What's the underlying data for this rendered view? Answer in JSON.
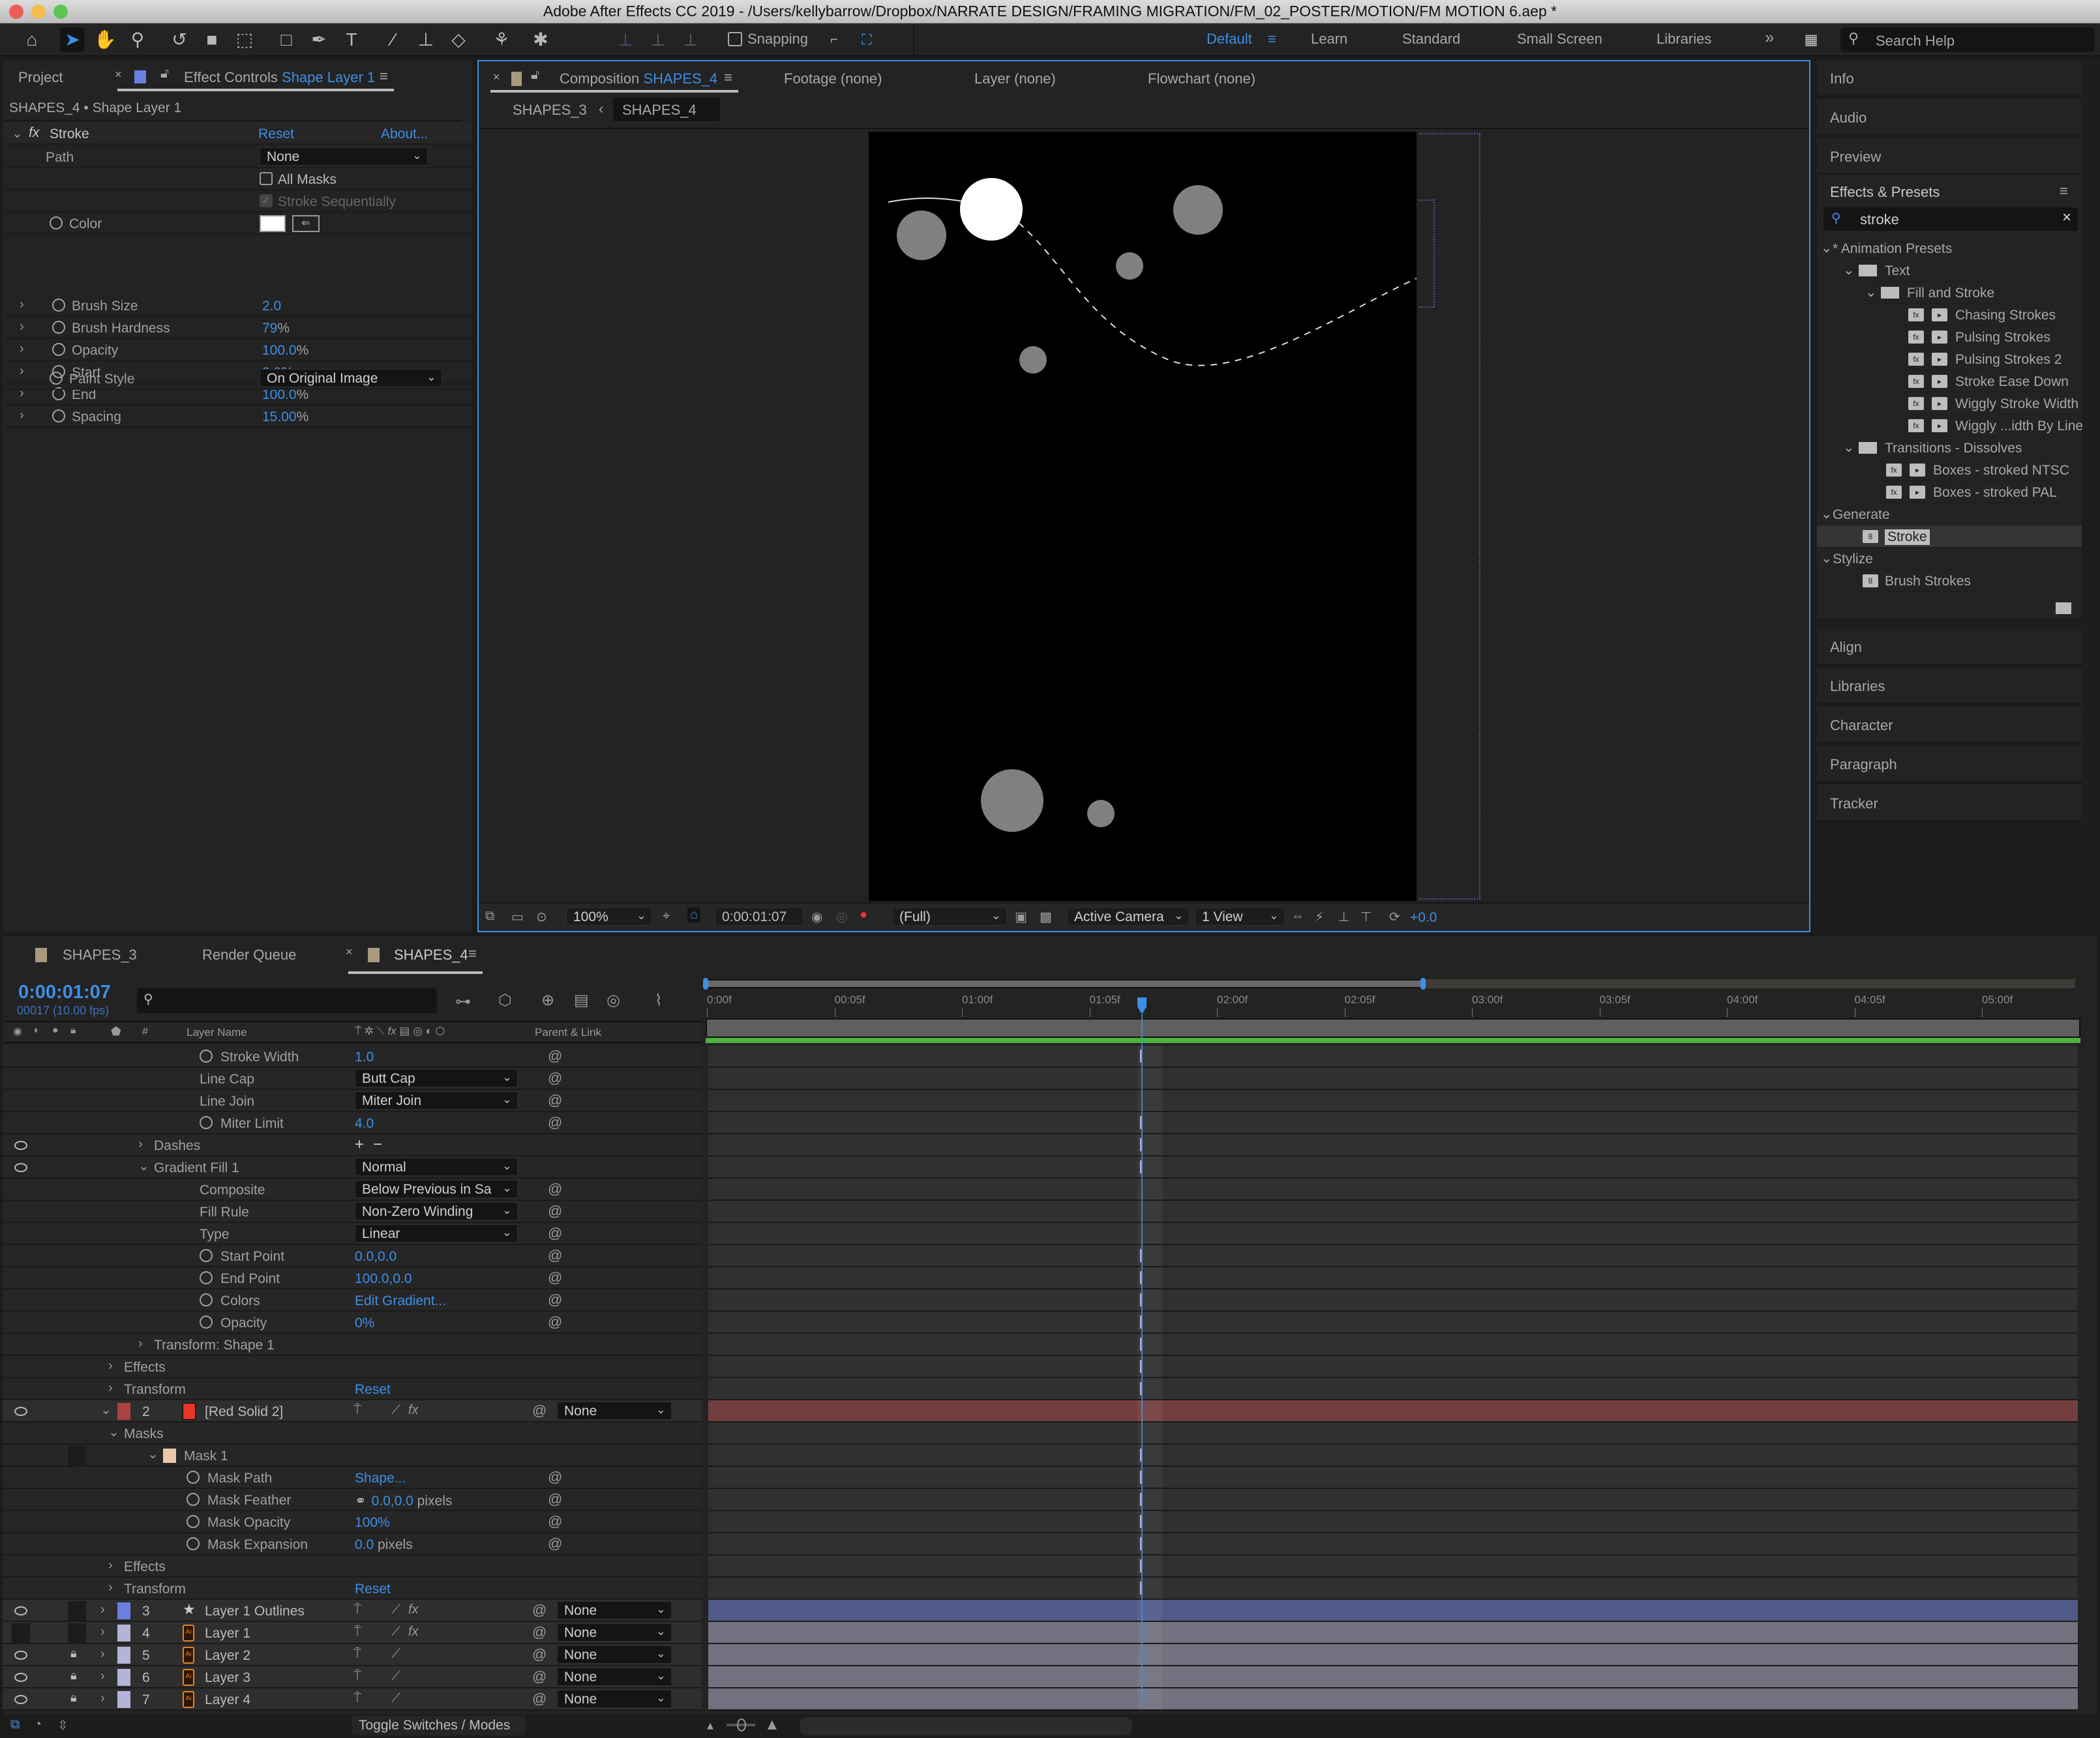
{
  "window": {
    "title": "Adobe After Effects CC 2019 - /Users/kellybarrow/Dropbox/NARRATE DESIGN/FRAMING MIGRATION/FM_02_POSTER/MOTION/FM  MOTION 6.aep *"
  },
  "toolbar": {
    "tools": [
      "home-icon",
      "selection-tool-icon",
      "hand-tool-icon",
      "zoom-tool-icon",
      "rotate-tool-icon",
      "camera-tool-icon",
      "pan-behind-tool-icon",
      "rectangle-tool-icon",
      "pen-tool-icon",
      "type-tool-icon",
      "brush-tool-icon",
      "clone-stamp-tool-icon",
      "eraser-tool-icon",
      "roto-brush-tool-icon",
      "puppet-pin-tool-icon"
    ],
    "snapping_label": "Snapping",
    "snapping_checked": false,
    "workspaces": [
      "Default",
      "Learn",
      "Standard",
      "Small Screen",
      "Libraries"
    ],
    "active_workspace": "Default",
    "more_label": "»",
    "search_placeholder": "Search Help"
  },
  "left_panel": {
    "tabs": {
      "project": "Project",
      "effect_controls_prefix": "Effect Controls",
      "effect_controls_layer": "Shape Layer 1"
    },
    "subtitle": "SHAPES_4 • Shape Layer 1",
    "effect": {
      "name": "Stroke",
      "reset": "Reset",
      "about": "About...",
      "path_label": "Path",
      "path_value": "None",
      "all_masks": "All Masks",
      "stroke_sequentially": "Stroke Sequentially",
      "color_label": "Color",
      "color_value": "#ffffff",
      "params": [
        {
          "label": "Brush Size",
          "value": "2.0",
          "unit": ""
        },
        {
          "label": "Brush Hardness",
          "value": "79",
          "unit": "%"
        },
        {
          "label": "Opacity",
          "value": "100.0",
          "unit": "%"
        },
        {
          "label": "Start",
          "value": "0.0",
          "unit": "%"
        },
        {
          "label": "End",
          "value": "100.0",
          "unit": "%"
        },
        {
          "label": "Spacing",
          "value": "15.00",
          "unit": "%"
        }
      ],
      "paint_style_label": "Paint Style",
      "paint_style_value": "On Original Image"
    }
  },
  "comp_panel": {
    "tab_prefix": "Composition",
    "tab_comp": "SHAPES_4",
    "other_tabs": [
      "Footage (none)",
      "Layer (none)",
      "Flowchart (none)"
    ],
    "breadcrumb": [
      "SHAPES_3",
      "SHAPES_4"
    ],
    "footer": {
      "zoom": "100%",
      "timecode": "0:00:01:07",
      "resolution": "(Full)",
      "camera": "Active Camera",
      "views": "1 View",
      "exposure": "+0.0"
    }
  },
  "right_panel": {
    "collapsed_top": [
      "Info",
      "Audio",
      "Preview"
    ],
    "effects_presets": {
      "title": "Effects & Presets",
      "search_value": "stroke",
      "tree": [
        {
          "label": "* Animation Presets",
          "level": 0,
          "type": "group"
        },
        {
          "label": "Text",
          "level": 1,
          "type": "folder"
        },
        {
          "label": "Fill and Stroke",
          "level": 2,
          "type": "folder"
        },
        {
          "label": "Chasing Strokes",
          "level": 3,
          "type": "preset"
        },
        {
          "label": "Pulsing Strokes",
          "level": 3,
          "type": "preset"
        },
        {
          "label": "Pulsing Strokes 2",
          "level": 3,
          "type": "preset"
        },
        {
          "label": "Stroke Ease Down",
          "level": 3,
          "type": "preset"
        },
        {
          "label": "Wiggly Stroke Width",
          "level": 3,
          "type": "preset"
        },
        {
          "label": "Wiggly ...idth By Line",
          "level": 3,
          "type": "preset"
        },
        {
          "label": "Transitions - Dissolves",
          "level": 1,
          "type": "folder"
        },
        {
          "label": "Boxes - stroked NTSC",
          "level": 2,
          "type": "preset"
        },
        {
          "label": "Boxes - stroked PAL",
          "level": 2,
          "type": "preset"
        },
        {
          "label": "Generate",
          "level": 0,
          "type": "group"
        },
        {
          "label": "Stroke",
          "level": 1,
          "type": "effect",
          "selected": true
        },
        {
          "label": "Stylize",
          "level": 0,
          "type": "group"
        },
        {
          "label": "Brush Strokes",
          "level": 1,
          "type": "effect"
        }
      ]
    },
    "collapsed_bottom": [
      "Align",
      "Libraries",
      "Character",
      "Paragraph",
      "Tracker"
    ]
  },
  "timeline": {
    "tabs": [
      "SHAPES_3",
      "Render Queue",
      "SHAPES_4"
    ],
    "active_tab": "SHAPES_4",
    "timecode": "0:00:01:07",
    "frame_info": "00017 (10.00 fps)",
    "columns": {
      "num": "#",
      "layer_name": "Layer Name",
      "parent": "Parent & Link"
    },
    "ruler": [
      "0:00f",
      "00:05f",
      "01:00f",
      "01:05f",
      "02:00f",
      "02:05f",
      "03:00f",
      "03:05f",
      "04:00f",
      "04:05f",
      "05:00f"
    ],
    "playhead_time": "0:00:01:07",
    "props": [
      {
        "label": "Stroke Width",
        "value": "1.0",
        "kind": "value",
        "stopwatch": true,
        "indent": 3
      },
      {
        "label": "Line Cap",
        "value": "Butt Cap",
        "kind": "dropdown",
        "stopwatch": false,
        "indent": 3
      },
      {
        "label": "Line Join",
        "value": "Miter Join",
        "kind": "dropdown",
        "stopwatch": false,
        "indent": 3
      },
      {
        "label": "Miter Limit",
        "value": "4.0",
        "kind": "value",
        "stopwatch": true,
        "indent": 3
      },
      {
        "label": "Dashes",
        "value": "",
        "kind": "dashes",
        "stopwatch": false,
        "indent": 2
      },
      {
        "label": "Gradient Fill 1",
        "value": "Normal",
        "kind": "dropdown-group",
        "stopwatch": false,
        "indent": 2
      },
      {
        "label": "Composite",
        "value": "Below Previous in Sa",
        "kind": "dropdown",
        "stopwatch": false,
        "indent": 3
      },
      {
        "label": "Fill Rule",
        "value": "Non-Zero Winding",
        "kind": "dropdown",
        "stopwatch": false,
        "indent": 3
      },
      {
        "label": "Type",
        "value": "Linear",
        "kind": "dropdown",
        "stopwatch": false,
        "indent": 3
      },
      {
        "label": "Start Point",
        "value": "0.0,0.0",
        "kind": "value",
        "stopwatch": true,
        "indent": 3
      },
      {
        "label": "End Point",
        "value": "100.0,0.0",
        "kind": "value",
        "stopwatch": true,
        "indent": 3
      },
      {
        "label": "Colors",
        "value": "Edit Gradient...",
        "kind": "value",
        "stopwatch": true,
        "indent": 3
      },
      {
        "label": "Opacity",
        "value": "0%",
        "kind": "value",
        "stopwatch": true,
        "indent": 3
      },
      {
        "label": "Transform: Shape 1",
        "value": "",
        "kind": "group",
        "stopwatch": false,
        "indent": 2
      },
      {
        "label": "Effects",
        "value": "",
        "kind": "group",
        "stopwatch": false,
        "indent": 1
      },
      {
        "label": "Transform",
        "value": "Reset",
        "kind": "group-reset",
        "stopwatch": false,
        "indent": 1
      }
    ],
    "red_solid": {
      "num": "2",
      "name": "[Red Solid 2]",
      "parent": "None",
      "label_color": "#a94442",
      "swatch_color": "#e8352b"
    },
    "mask_props": [
      {
        "label": "Masks",
        "value": "",
        "kind": "group",
        "indent": 1
      },
      {
        "label": "Mask 1",
        "value": "",
        "kind": "mask",
        "indent": 2
      },
      {
        "label": "Mask Path",
        "value": "Shape...",
        "suffix": "",
        "kind": "value",
        "indent": 3
      },
      {
        "label": "Mask Feather",
        "value": "0.0,0.0",
        "suffix": " pixels",
        "kind": "value",
        "indent": 3
      },
      {
        "label": "Mask Opacity",
        "value": "100%",
        "suffix": "",
        "kind": "value",
        "indent": 3
      },
      {
        "label": "Mask Expansion",
        "value": "0.0",
        "suffix": " pixels",
        "kind": "value",
        "indent": 3
      },
      {
        "label": "Effects",
        "value": "",
        "kind": "group",
        "indent": 1
      },
      {
        "label": "Transform",
        "value": "Reset",
        "kind": "group-reset",
        "indent": 1
      }
    ],
    "layers": [
      {
        "num": "3",
        "name": "Layer 1 Outlines",
        "type": "shape",
        "parent": "None",
        "locked": false,
        "visible": true,
        "color": "#6b7fe0",
        "bar": "#505a88",
        "fx": true
      },
      {
        "num": "4",
        "name": "Layer 1",
        "type": "ai",
        "parent": "None",
        "locked": false,
        "visible": false,
        "color": "#b4b4d8",
        "bar": "#71717f",
        "fx": true
      },
      {
        "num": "5",
        "name": "Layer 2",
        "type": "ai",
        "parent": "None",
        "locked": true,
        "visible": true,
        "color": "#b4b4d8",
        "bar": "#71717f",
        "fx": false
      },
      {
        "num": "6",
        "name": "Layer 3",
        "type": "ai",
        "parent": "None",
        "locked": true,
        "visible": true,
        "color": "#b4b4d8",
        "bar": "#71717f",
        "fx": false
      },
      {
        "num": "7",
        "name": "Layer 4",
        "type": "ai",
        "parent": "None",
        "locked": true,
        "visible": true,
        "color": "#b4b4d8",
        "bar": "#71717f",
        "fx": false
      }
    ],
    "toggle_label": "Toggle Switches / Modes"
  },
  "colors": {
    "accent": "#3d8fe6",
    "panel": "#232323",
    "work_area_green": "#4db33d"
  }
}
